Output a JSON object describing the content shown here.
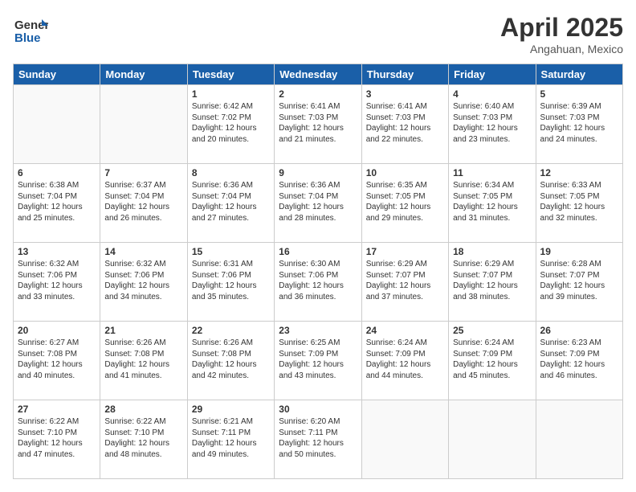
{
  "header": {
    "logo_line1": "General",
    "logo_line2": "Blue",
    "main_title": "April 2025",
    "subtitle": "Angahuan, Mexico"
  },
  "weekdays": [
    "Sunday",
    "Monday",
    "Tuesday",
    "Wednesday",
    "Thursday",
    "Friday",
    "Saturday"
  ],
  "weeks": [
    [
      {
        "num": "",
        "info": ""
      },
      {
        "num": "",
        "info": ""
      },
      {
        "num": "1",
        "info": "Sunrise: 6:42 AM\nSunset: 7:02 PM\nDaylight: 12 hours and 20 minutes."
      },
      {
        "num": "2",
        "info": "Sunrise: 6:41 AM\nSunset: 7:03 PM\nDaylight: 12 hours and 21 minutes."
      },
      {
        "num": "3",
        "info": "Sunrise: 6:41 AM\nSunset: 7:03 PM\nDaylight: 12 hours and 22 minutes."
      },
      {
        "num": "4",
        "info": "Sunrise: 6:40 AM\nSunset: 7:03 PM\nDaylight: 12 hours and 23 minutes."
      },
      {
        "num": "5",
        "info": "Sunrise: 6:39 AM\nSunset: 7:03 PM\nDaylight: 12 hours and 24 minutes."
      }
    ],
    [
      {
        "num": "6",
        "info": "Sunrise: 6:38 AM\nSunset: 7:04 PM\nDaylight: 12 hours and 25 minutes."
      },
      {
        "num": "7",
        "info": "Sunrise: 6:37 AM\nSunset: 7:04 PM\nDaylight: 12 hours and 26 minutes."
      },
      {
        "num": "8",
        "info": "Sunrise: 6:36 AM\nSunset: 7:04 PM\nDaylight: 12 hours and 27 minutes."
      },
      {
        "num": "9",
        "info": "Sunrise: 6:36 AM\nSunset: 7:04 PM\nDaylight: 12 hours and 28 minutes."
      },
      {
        "num": "10",
        "info": "Sunrise: 6:35 AM\nSunset: 7:05 PM\nDaylight: 12 hours and 29 minutes."
      },
      {
        "num": "11",
        "info": "Sunrise: 6:34 AM\nSunset: 7:05 PM\nDaylight: 12 hours and 31 minutes."
      },
      {
        "num": "12",
        "info": "Sunrise: 6:33 AM\nSunset: 7:05 PM\nDaylight: 12 hours and 32 minutes."
      }
    ],
    [
      {
        "num": "13",
        "info": "Sunrise: 6:32 AM\nSunset: 7:06 PM\nDaylight: 12 hours and 33 minutes."
      },
      {
        "num": "14",
        "info": "Sunrise: 6:32 AM\nSunset: 7:06 PM\nDaylight: 12 hours and 34 minutes."
      },
      {
        "num": "15",
        "info": "Sunrise: 6:31 AM\nSunset: 7:06 PM\nDaylight: 12 hours and 35 minutes."
      },
      {
        "num": "16",
        "info": "Sunrise: 6:30 AM\nSunset: 7:06 PM\nDaylight: 12 hours and 36 minutes."
      },
      {
        "num": "17",
        "info": "Sunrise: 6:29 AM\nSunset: 7:07 PM\nDaylight: 12 hours and 37 minutes."
      },
      {
        "num": "18",
        "info": "Sunrise: 6:29 AM\nSunset: 7:07 PM\nDaylight: 12 hours and 38 minutes."
      },
      {
        "num": "19",
        "info": "Sunrise: 6:28 AM\nSunset: 7:07 PM\nDaylight: 12 hours and 39 minutes."
      }
    ],
    [
      {
        "num": "20",
        "info": "Sunrise: 6:27 AM\nSunset: 7:08 PM\nDaylight: 12 hours and 40 minutes."
      },
      {
        "num": "21",
        "info": "Sunrise: 6:26 AM\nSunset: 7:08 PM\nDaylight: 12 hours and 41 minutes."
      },
      {
        "num": "22",
        "info": "Sunrise: 6:26 AM\nSunset: 7:08 PM\nDaylight: 12 hours and 42 minutes."
      },
      {
        "num": "23",
        "info": "Sunrise: 6:25 AM\nSunset: 7:09 PM\nDaylight: 12 hours and 43 minutes."
      },
      {
        "num": "24",
        "info": "Sunrise: 6:24 AM\nSunset: 7:09 PM\nDaylight: 12 hours and 44 minutes."
      },
      {
        "num": "25",
        "info": "Sunrise: 6:24 AM\nSunset: 7:09 PM\nDaylight: 12 hours and 45 minutes."
      },
      {
        "num": "26",
        "info": "Sunrise: 6:23 AM\nSunset: 7:09 PM\nDaylight: 12 hours and 46 minutes."
      }
    ],
    [
      {
        "num": "27",
        "info": "Sunrise: 6:22 AM\nSunset: 7:10 PM\nDaylight: 12 hours and 47 minutes."
      },
      {
        "num": "28",
        "info": "Sunrise: 6:22 AM\nSunset: 7:10 PM\nDaylight: 12 hours and 48 minutes."
      },
      {
        "num": "29",
        "info": "Sunrise: 6:21 AM\nSunset: 7:11 PM\nDaylight: 12 hours and 49 minutes."
      },
      {
        "num": "30",
        "info": "Sunrise: 6:20 AM\nSunset: 7:11 PM\nDaylight: 12 hours and 50 minutes."
      },
      {
        "num": "",
        "info": ""
      },
      {
        "num": "",
        "info": ""
      },
      {
        "num": "",
        "info": ""
      }
    ]
  ]
}
